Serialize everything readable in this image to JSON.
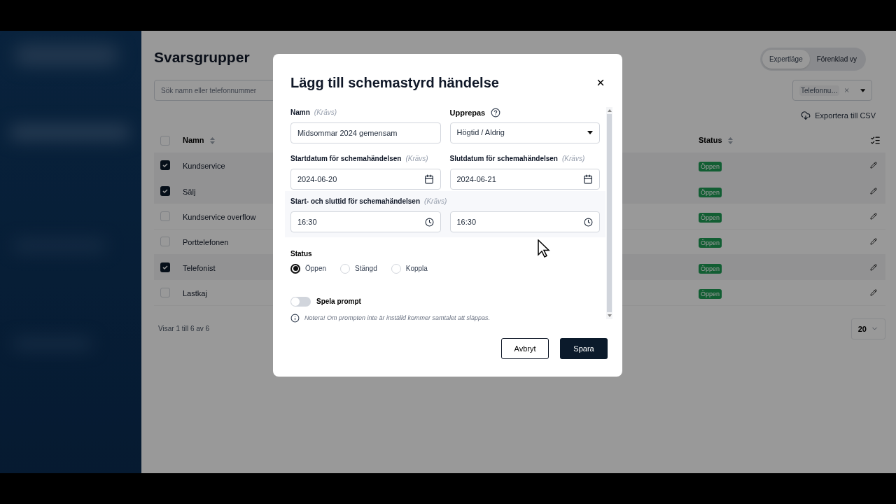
{
  "page": {
    "title": "Svarsgrupper",
    "view_modes": [
      {
        "label": "Expertläge",
        "selected": true
      },
      {
        "label": "Förenklad vy",
        "selected": false
      }
    ],
    "search": {
      "placeholder": "Sök namn eller telefonnummer"
    },
    "filter": {
      "chip": "Telefonnu…"
    },
    "export": "Exportera till CSV",
    "table": {
      "columns": [
        "Namn",
        "Status"
      ],
      "all_checked": false,
      "rows": [
        {
          "name": "Kundservice",
          "checked": true,
          "status": "Öppen"
        },
        {
          "name": "Sälj",
          "checked": true,
          "status": "Öppen"
        },
        {
          "name": "Kundservice overflow",
          "checked": false,
          "status": "Öppen"
        },
        {
          "name": "Porttelefonen",
          "checked": false,
          "status": "Öppen"
        },
        {
          "name": "Telefonist",
          "checked": true,
          "status": "Öppen"
        },
        {
          "name": "Lastkaj",
          "checked": false,
          "status": "Öppen"
        }
      ]
    },
    "footer": "Visar 1 till 6 av 6",
    "page_size": "20"
  },
  "dialog": {
    "title": "Lägg till schemastyrd händelse",
    "name": {
      "label": "Namn",
      "required": "(Krävs)",
      "value": "Midsommar 2024 gemensam"
    },
    "repeat": {
      "label": "Upprepas",
      "value": "Högtid / Aldrig"
    },
    "start_date": {
      "label": "Startdatum för schemahändelsen",
      "required": "(Krävs)",
      "value": "2024-06-20"
    },
    "end_date": {
      "label": "Slutdatum för schemahändelsen",
      "required": "(Krävs)",
      "value": "2024-06-21"
    },
    "time": {
      "label": "Start- och sluttid för schemahändelsen",
      "required": "(Krävs)",
      "start": "16:30",
      "end": "16:30"
    },
    "status": {
      "label": "Status",
      "options": [
        {
          "label": "Öppen",
          "selected": true
        },
        {
          "label": "Stängd",
          "selected": false
        },
        {
          "label": "Koppla",
          "selected": false
        }
      ]
    },
    "prompt": {
      "label": "Spela prompt",
      "on": false
    },
    "note": "Notera! Om prompten inte är inställd kommer samtalet att släppas.",
    "cancel": "Avbryt",
    "save": "Spara"
  }
}
